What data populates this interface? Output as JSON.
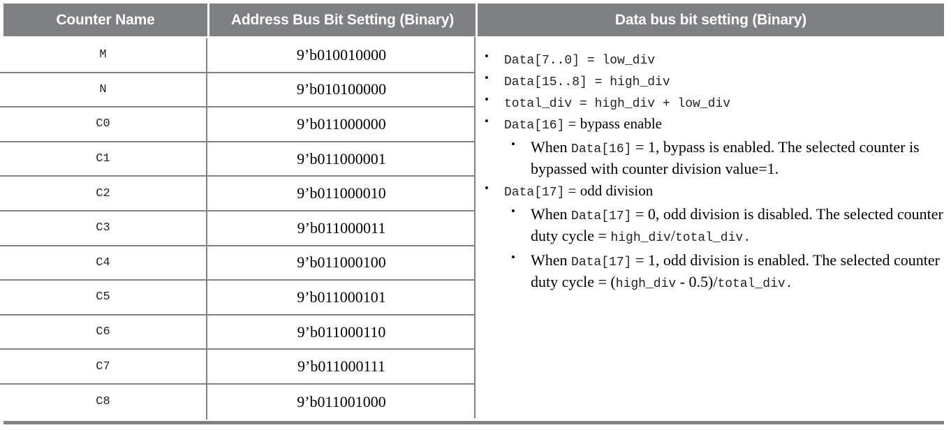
{
  "table": {
    "headers": {
      "counter_name": "Counter Name",
      "address_bus": "Address Bus Bit Setting (Binary)",
      "data_bus": "Data bus bit setting (Binary)"
    },
    "rows": [
      {
        "counter": "M",
        "address": "9’b010010000"
      },
      {
        "counter": "N",
        "address": "9’b010100000"
      },
      {
        "counter": "C0",
        "address": "9’b011000000"
      },
      {
        "counter": "C1",
        "address": "9’b011000001"
      },
      {
        "counter": "C2",
        "address": "9’b011000010"
      },
      {
        "counter": "C3",
        "address": "9’b011000011"
      },
      {
        "counter": "C4",
        "address": "9’b011000100"
      },
      {
        "counter": "C5",
        "address": "9’b011000101"
      },
      {
        "counter": "C6",
        "address": "9’b011000110"
      },
      {
        "counter": "C7",
        "address": "9’b011000111"
      },
      {
        "counter": "C8",
        "address": "9’b011001000"
      }
    ]
  },
  "data_bus": {
    "bullets": {
      "b1": {
        "code1": "Data[7..0]",
        "eq": " = ",
        "code2": "low_div"
      },
      "b2": {
        "code1": "Data[15..8]",
        "eq": " = ",
        "code2": "high_div"
      },
      "b3": {
        "code1": "total_div",
        "eq": " = ",
        "code2": "high_div",
        "plus": " + ",
        "code3": "low_div"
      },
      "b4": {
        "code1": "Data[16]",
        "eq": " = ",
        "text": "bypass enable"
      },
      "b4_sub": {
        "pre": "When ",
        "code1": "Data[16]",
        "post": " = 1, bypass is enabled. The selected counter is bypassed with counter division value=1."
      },
      "b5": {
        "code1": "Data[17]",
        "eq": " = ",
        "text": "odd division"
      },
      "b5_sub1": {
        "pre": "When ",
        "code1": "Data[17]",
        "mid": " = 0, odd division is disabled. The selected counter duty cycle = ",
        "code2": "high_div",
        "slash": "/",
        "code3": "total_div",
        "end": "."
      },
      "b5_sub2": {
        "pre": "When ",
        "code1": "Data[17]",
        "mid": " = 1, odd division is enabled. The selected counter duty cycle = (",
        "code2": "high_div",
        "mid2": " - 0.5)/",
        "code3": "total_div",
        "end": "."
      }
    }
  },
  "colors": {
    "header_bg": "#7f8083",
    "header_text": "#ffffff",
    "border": "#808184",
    "body_text": "#231f20",
    "page_bg": "#ffffff"
  }
}
